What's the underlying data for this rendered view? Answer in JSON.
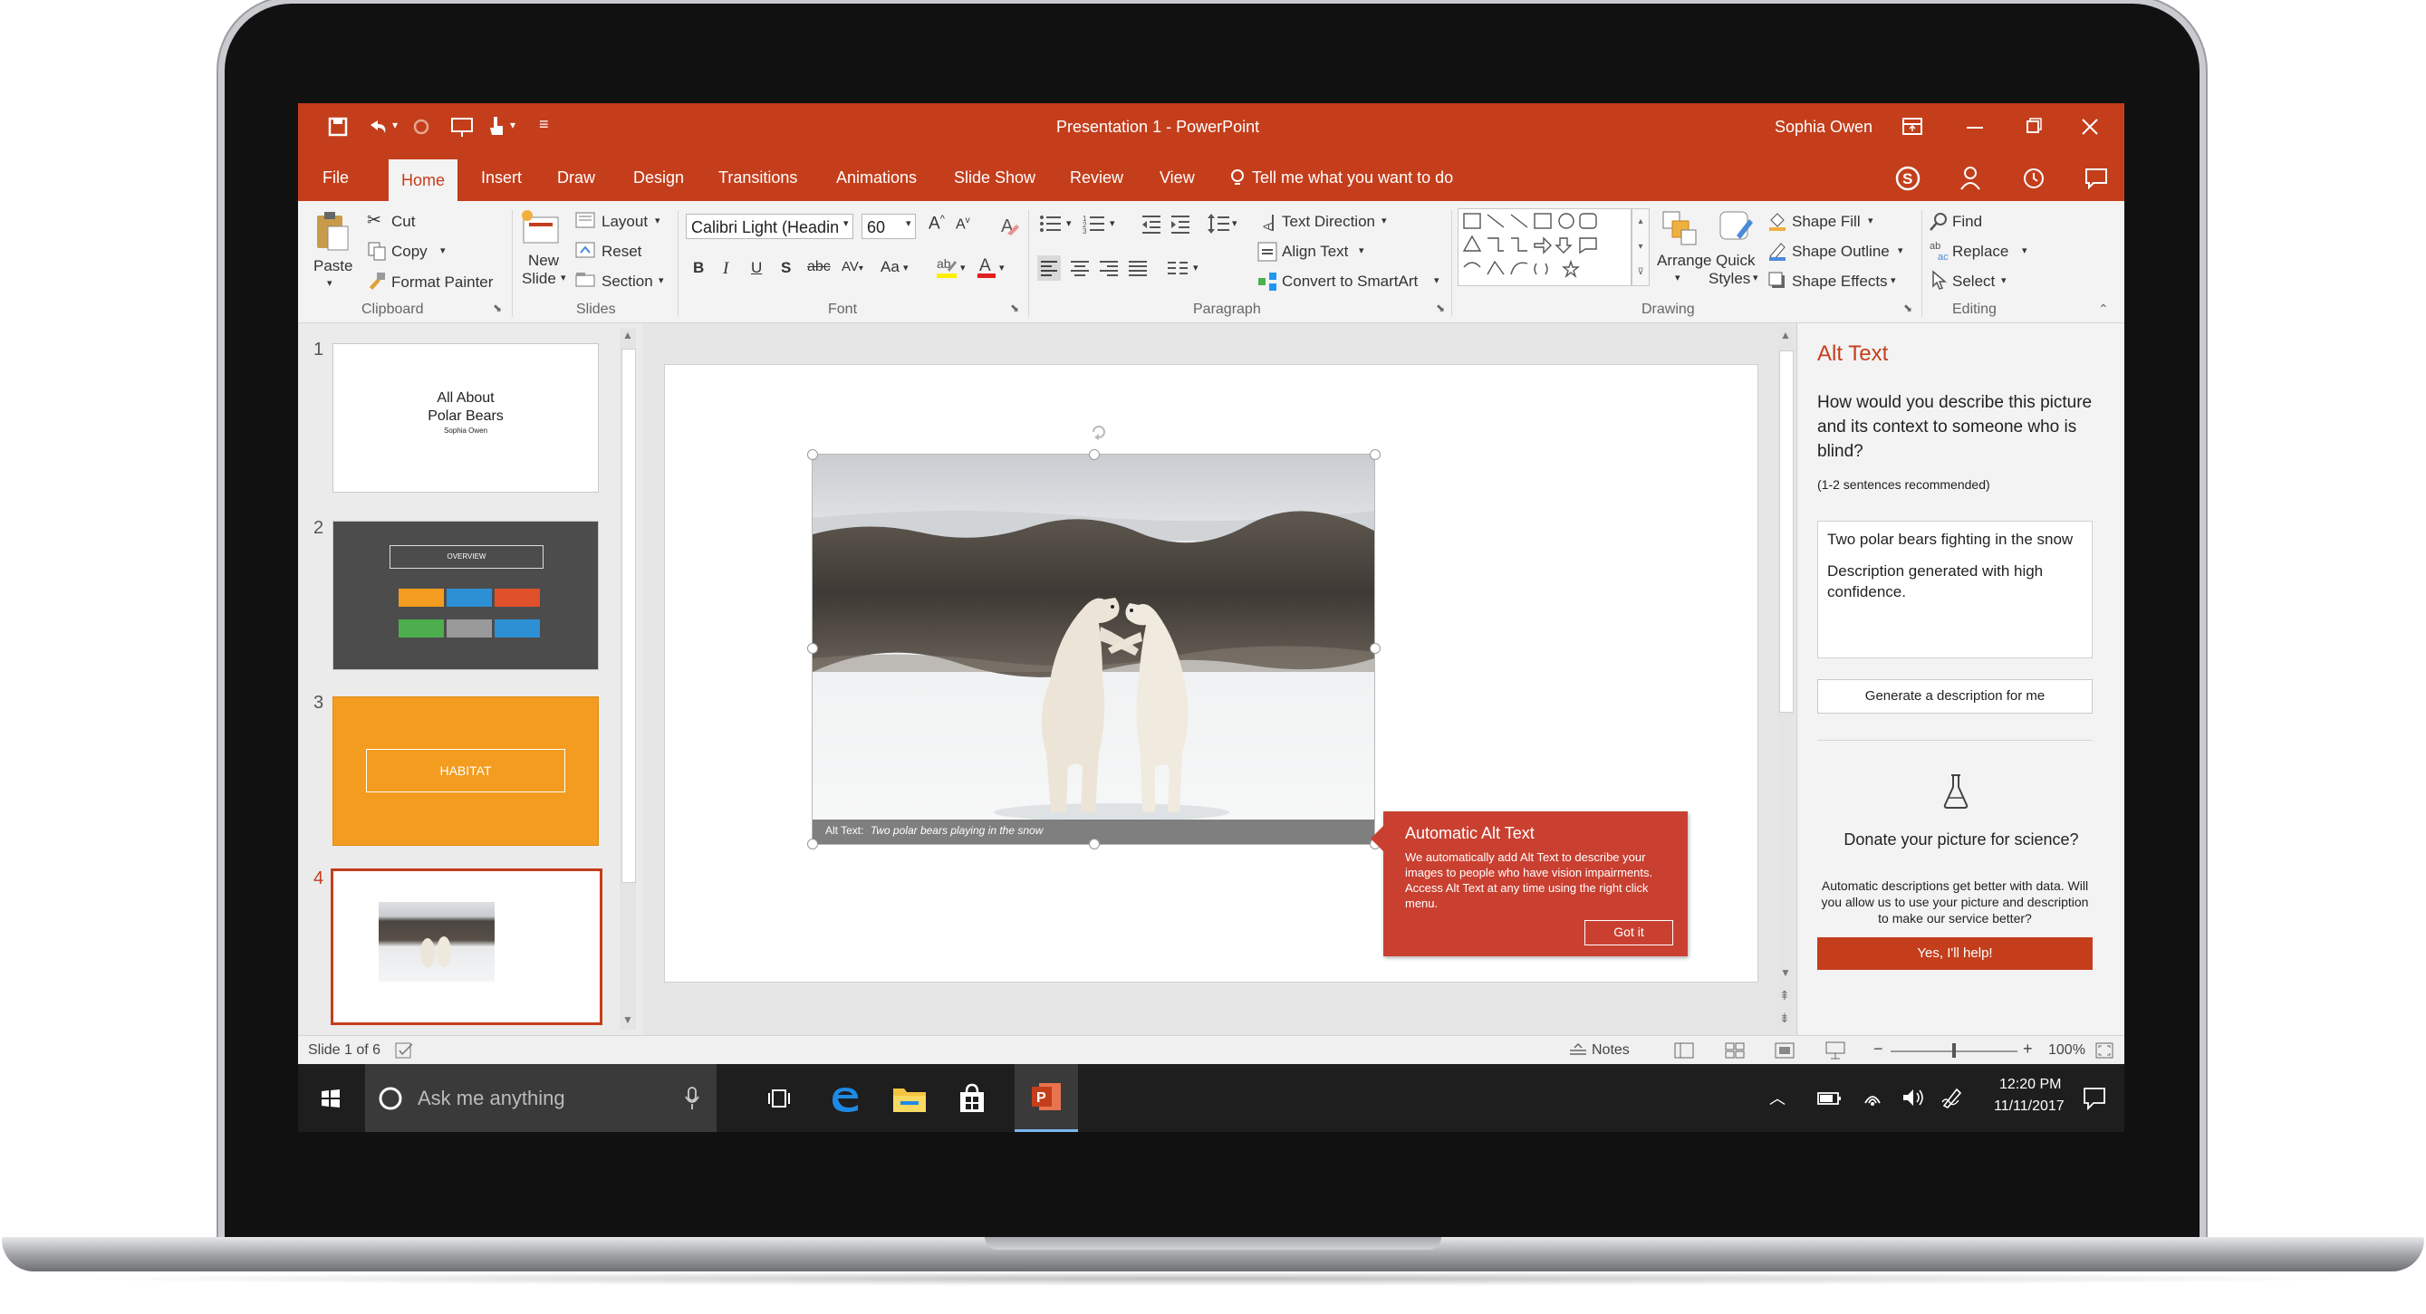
{
  "titlebar": {
    "title": "Presentation 1 - PowerPoint",
    "user": "Sophia Owen"
  },
  "tabs": [
    {
      "label": "File"
    },
    {
      "label": "Home"
    },
    {
      "label": "Insert"
    },
    {
      "label": "Draw"
    },
    {
      "label": "Design"
    },
    {
      "label": "Transitions"
    },
    {
      "label": "Animations"
    },
    {
      "label": "Slide Show"
    },
    {
      "label": "Review"
    },
    {
      "label": "View"
    }
  ],
  "tell_me": "Tell me what you want to do",
  "ribbon": {
    "clipboard": {
      "paste": "Paste",
      "cut": "Cut",
      "copy": "Copy",
      "format_painter": "Format Painter",
      "group": "Clipboard"
    },
    "slides": {
      "new_slide_1": "New",
      "new_slide_2": "Slide",
      "layout": "Layout",
      "reset": "Reset",
      "section": "Section",
      "group": "Slides"
    },
    "font": {
      "name": "Calibri Light (Headin",
      "size": "60",
      "group": "Font",
      "bold": "B",
      "italic": "I",
      "underline": "U",
      "shadow": "S",
      "strike": "abc",
      "change_case": "Aa"
    },
    "paragraph": {
      "text_direction": "Text Direction",
      "align_text": "Align Text",
      "smartart": "Convert to SmartArt",
      "group": "Paragraph"
    },
    "drawing": {
      "arrange": "Arrange",
      "quick_styles_1": "Quick",
      "quick_styles_2": "Styles",
      "shape_fill": "Shape Fill",
      "shape_outline": "Shape Outline",
      "shape_effects": "Shape Effects",
      "group": "Drawing"
    },
    "editing": {
      "find": "Find",
      "replace": "Replace",
      "select": "Select",
      "group": "Editing"
    }
  },
  "thumbnails": {
    "n1": "1",
    "n2": "2",
    "n3": "3",
    "n4": "4",
    "s1_title_1": "All About",
    "s1_title_2": "Polar Bears",
    "s1_sub": "Sophia Owen",
    "s2_title": "OVERVIEW",
    "s3_title": "HABITAT"
  },
  "slide": {
    "caption_label": "Alt Text:",
    "caption_text": "Two polar bears playing in the snow"
  },
  "callout": {
    "title": "Automatic Alt Text",
    "body": "We automatically add Alt Text to describe your images to people who have vision impairments. Access Alt Text at any time using the right click menu.",
    "button": "Got it"
  },
  "alt_pane": {
    "title": "Alt Text",
    "question": "How would you describe this picture and its context to someone who is blind?",
    "hint": "(1-2 sentences recommended)",
    "text_1": "Two polar bears fighting in the snow",
    "text_2": "Description generated with high confidence.",
    "generate": "Generate a description for me",
    "donate_title": "Donate your picture for science?",
    "donate_body": "Automatic descriptions get better with data. Will you allow us to use your picture and description to make our service better?",
    "donate_button": "Yes, I'll help!"
  },
  "status": {
    "slide_of": "Slide 1 of 6",
    "notes": "Notes",
    "zoom": "100%"
  },
  "taskbar": {
    "search_placeholder": "Ask me anything",
    "time": "12:20 PM",
    "date": "11/11/2017"
  },
  "colors": {
    "accent": "#c43e1c",
    "slide3": "#f39c1f",
    "slide2": "#4c4c4c"
  }
}
